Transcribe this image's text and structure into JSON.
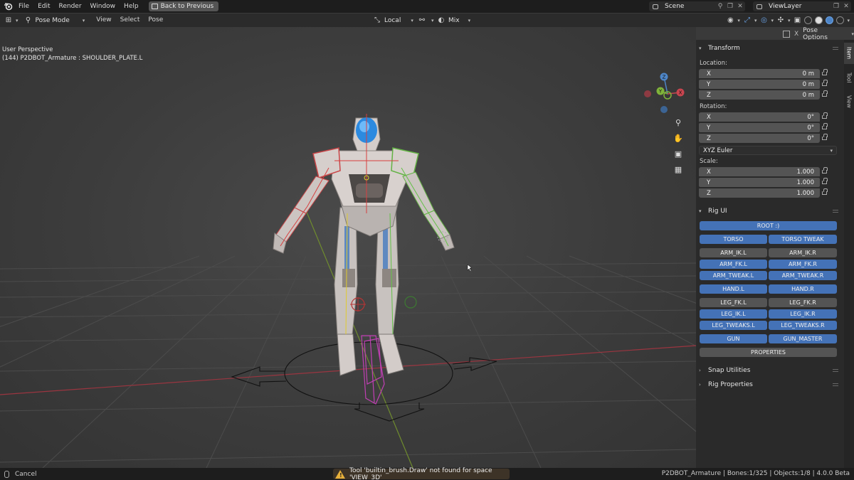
{
  "topbar": {
    "menus": [
      "File",
      "Edit",
      "Render",
      "Window",
      "Help"
    ],
    "back_button": "Back to Previous",
    "scene": "Scene",
    "view_layer": "ViewLayer"
  },
  "header": {
    "mode": "Pose Mode",
    "menus": [
      "View",
      "Select",
      "Pose"
    ],
    "orientation": "Local",
    "blend": "Mix"
  },
  "viewport": {
    "perspective": "User Perspective",
    "active": "(144) P2DBOT_Armature : SHOULDER_PLATE.L",
    "pose_options": "Pose Options",
    "gizmo_axes": [
      "X",
      "Y",
      "Z"
    ]
  },
  "sidebar": {
    "tabs": [
      "Item",
      "Tool",
      "View"
    ],
    "transform": {
      "title": "Transform",
      "location_label": "Location:",
      "location": [
        {
          "axis": "X",
          "value": "0 m"
        },
        {
          "axis": "Y",
          "value": "0 m"
        },
        {
          "axis": "Z",
          "value": "0 m"
        }
      ],
      "rotation_label": "Rotation:",
      "rotation": [
        {
          "axis": "X",
          "value": "0°"
        },
        {
          "axis": "Y",
          "value": "0°"
        },
        {
          "axis": "Z",
          "value": "0°"
        }
      ],
      "rotation_mode": "XYZ Euler",
      "scale_label": "Scale:",
      "scale": [
        {
          "axis": "X",
          "value": "1.000"
        },
        {
          "axis": "Y",
          "value": "1.000"
        },
        {
          "axis": "Z",
          "value": "1.000"
        }
      ]
    },
    "rig_ui": {
      "title": "Rig UI",
      "root": "ROOT :)",
      "rows": [
        {
          "left": "TORSO",
          "right": "TORSO TWEAK",
          "on": true
        },
        {
          "left": "ARM_IK.L",
          "right": "ARM_IK.R",
          "on": false
        },
        {
          "left": "ARM_FK.L",
          "right": "ARM_FK.R",
          "on": true
        },
        {
          "left": "ARM_TWEAK.L",
          "right": "ARM_TWEAK.R",
          "on": true
        },
        {
          "left": "HAND.L",
          "right": "HAND.R",
          "on": true
        },
        {
          "left": "LEG_FK.L",
          "right": "LEG_FK.R",
          "on": false
        },
        {
          "left": "LEG_IK.L",
          "right": "LEG_IK.R",
          "on": true
        },
        {
          "left": "LEG_TWEAKS.L",
          "right": "LEG_TWEAKS.R",
          "on": true
        },
        {
          "left": "GUN",
          "right": "GUN_MASTER",
          "on": true
        }
      ],
      "properties": "PROPERTIES"
    },
    "snap_utilities": "Snap Utilities",
    "rig_properties": "Rig Properties"
  },
  "status": {
    "cancel": "Cancel",
    "warning": "Tool 'builtin_brush.Draw' not found for space 'VIEW_3D'",
    "stats": "P2DBOT_Armature | Bones:1/325 | Objects:1/8 | 4.0.0 Beta"
  },
  "colors": {
    "accent_blue": "#4472b7",
    "x_axis": "#c8454f",
    "y_axis": "#7fb33a",
    "z_axis": "#4e86c8"
  }
}
